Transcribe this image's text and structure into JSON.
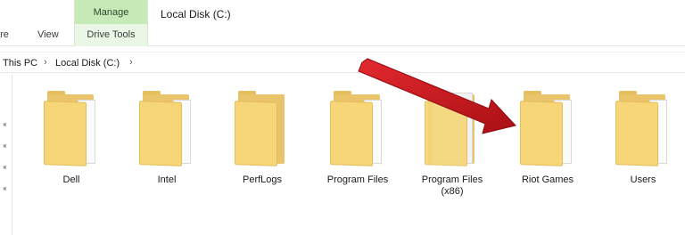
{
  "ribbon": {
    "tab_share": "are",
    "tab_view": "View",
    "manage_label": "Manage",
    "drive_tools_label": "Drive Tools",
    "window_title": "Local Disk (C:)"
  },
  "address": {
    "crumb_this_pc": "This PC",
    "sep": "›",
    "crumb_local_disk": "Local Disk (C:)",
    "trailing_sep": "›"
  },
  "folders": [
    {
      "name": "Dell",
      "icon": "folder-icon"
    },
    {
      "name": "Intel",
      "icon": "folder-icon"
    },
    {
      "name": "PerfLogs",
      "icon": "empty-folder-icon"
    },
    {
      "name": "Program Files",
      "icon": "folder-icon"
    },
    {
      "name": "Program Files",
      "sub": "(x86)",
      "icon": "folder-icon"
    },
    {
      "name": "Riot Games",
      "icon": "folder-icon"
    },
    {
      "name": "Users",
      "icon": "folder-icon"
    }
  ],
  "colors": {
    "manage_accent": "#c7eab9",
    "folder_yellow": "#f6d676",
    "arrow_red": "#c0161b"
  }
}
